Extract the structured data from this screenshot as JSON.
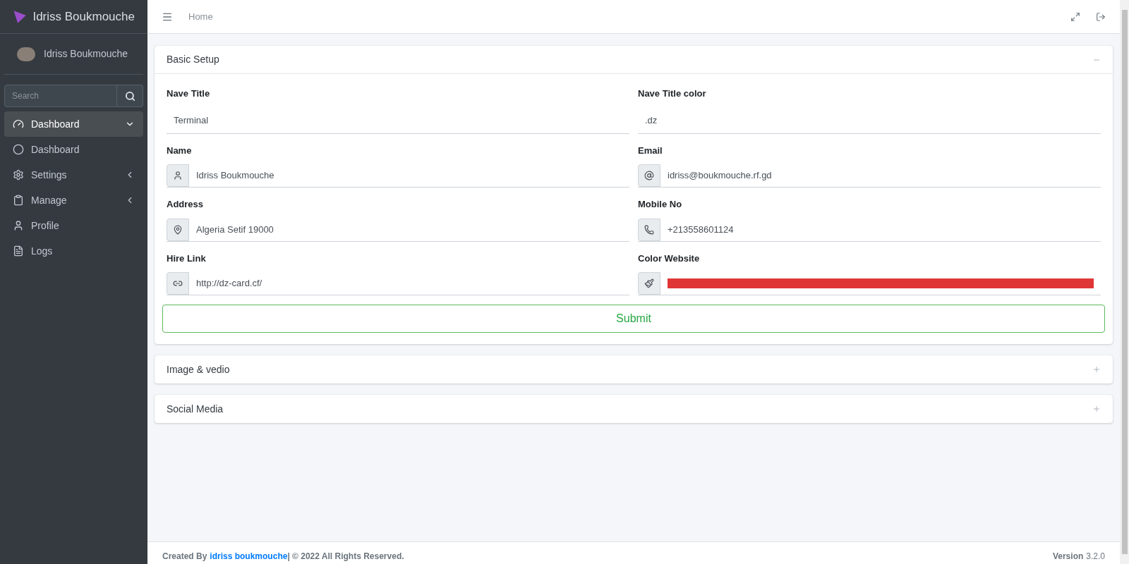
{
  "brand": {
    "title": "Idriss Boukmouche"
  },
  "user": {
    "name": "Idriss Boukmouche"
  },
  "search": {
    "placeholder": "Search"
  },
  "sidebar": {
    "items": [
      {
        "label": "Dashboard",
        "selected": true,
        "expanded": true,
        "children": [
          {
            "label": "Dashboard",
            "selected": false
          }
        ]
      },
      {
        "label": "Settings",
        "selected": false,
        "expanded": false
      },
      {
        "label": "Manage",
        "selected": false,
        "expanded": false
      },
      {
        "label": "Profile",
        "selected": false
      },
      {
        "label": "Logs",
        "selected": false
      }
    ]
  },
  "topbar": {
    "breadcrumb": "Home"
  },
  "sections": [
    {
      "title": "Basic Setup",
      "expanded": true,
      "fields": [
        {
          "kind": "plain",
          "label": "Nave Title",
          "value": "Terminal"
        },
        {
          "kind": "plain",
          "label": "Nave Title color",
          "value": ".dz"
        },
        {
          "kind": "icon",
          "label": "Name",
          "value": "Idriss Boukmouche"
        },
        {
          "kind": "icon",
          "label": "Email",
          "value": "idriss@boukmouche.rf.gd"
        },
        {
          "kind": "icon",
          "label": "Address",
          "value": "Algeria Setif 19000"
        },
        {
          "kind": "icon",
          "label": "Mobile No",
          "value": "+213558601124"
        },
        {
          "kind": "icon",
          "label": "Hire Link",
          "value": "http://dz-card.cf/"
        },
        {
          "kind": "color",
          "label": "Color Website",
          "color": "#e03535"
        }
      ],
      "submit": "Submit"
    },
    {
      "title": "Image & vedio",
      "expanded": false
    },
    {
      "title": "Social Media",
      "expanded": false
    }
  ],
  "footer": {
    "prefix": "Created By",
    "link": "idriss boukmouche",
    "suffix": "| © 2022 All Rights Reserved.",
    "version_label": "Version",
    "version": "3.2.0"
  }
}
